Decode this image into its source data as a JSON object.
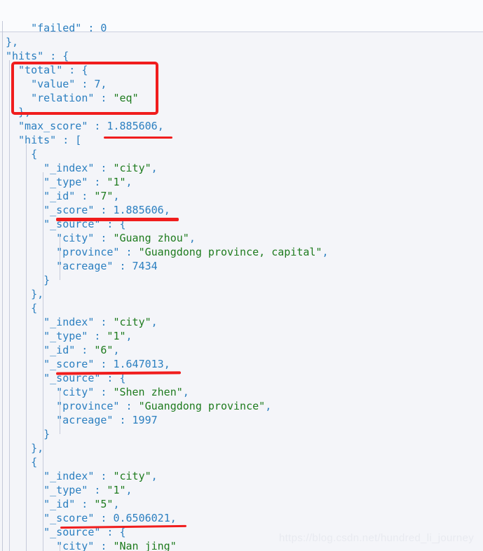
{
  "app": {
    "kind": "json-response-viewer",
    "language": "json"
  },
  "colors": {
    "background": "#f4f5f9",
    "top_band": "#fafbfd",
    "divider": "#ccd0e0",
    "key": "#2b7fc0",
    "string": "#1e7b1e",
    "annotation": "#f01d1d",
    "indent_guide": "#c6cbdb",
    "watermark": "#e8eaf0"
  },
  "code_lines": [
    {
      "indent": 4,
      "text": "\"failed\" : 0",
      "clipped": true
    },
    {
      "indent": 0,
      "text": "},"
    },
    {
      "indent": 0,
      "text": "\"hits\" : {"
    },
    {
      "indent": 2,
      "text": "\"total\" : {"
    },
    {
      "indent": 4,
      "text": "\"value\" : 7,"
    },
    {
      "indent": 4,
      "text": "\"relation\" : \"eq\""
    },
    {
      "indent": 2,
      "text": "},"
    },
    {
      "indent": 2,
      "text": "\"max_score\" : 1.885606,"
    },
    {
      "indent": 2,
      "text": "\"hits\" : ["
    },
    {
      "indent": 4,
      "text": "{"
    },
    {
      "indent": 6,
      "text": "\"_index\" : \"city\","
    },
    {
      "indent": 6,
      "text": "\"_type\" : \"1\","
    },
    {
      "indent": 6,
      "text": "\"_id\" : \"7\","
    },
    {
      "indent": 6,
      "text": "\"_score\" : 1.885606,"
    },
    {
      "indent": 6,
      "text": "\"_source\" : {"
    },
    {
      "indent": 8,
      "text": "\"city\" : \"Guang zhou\","
    },
    {
      "indent": 8,
      "text": "\"province\" : \"Guangdong province, capital\","
    },
    {
      "indent": 8,
      "text": "\"acreage\" : 7434"
    },
    {
      "indent": 6,
      "text": "}"
    },
    {
      "indent": 4,
      "text": "},"
    },
    {
      "indent": 4,
      "text": "{"
    },
    {
      "indent": 6,
      "text": "\"_index\" : \"city\","
    },
    {
      "indent": 6,
      "text": "\"_type\" : \"1\","
    },
    {
      "indent": 6,
      "text": "\"_id\" : \"6\","
    },
    {
      "indent": 6,
      "text": "\"_score\" : 1.647013,"
    },
    {
      "indent": 6,
      "text": "\"_source\" : {"
    },
    {
      "indent": 8,
      "text": "\"city\" : \"Shen zhen\","
    },
    {
      "indent": 8,
      "text": "\"province\" : \"Guangdong province\","
    },
    {
      "indent": 8,
      "text": "\"acreage\" : 1997"
    },
    {
      "indent": 6,
      "text": "}"
    },
    {
      "indent": 4,
      "text": "},"
    },
    {
      "indent": 4,
      "text": "{"
    },
    {
      "indent": 6,
      "text": "\"_index\" : \"city\","
    },
    {
      "indent": 6,
      "text": "\"_type\" : \"1\","
    },
    {
      "indent": 6,
      "text": "\"_id\" : \"5\","
    },
    {
      "indent": 6,
      "text": "\"_score\" : 0.6506021,"
    },
    {
      "indent": 6,
      "text": "\"_source\" : {"
    },
    {
      "indent": 8,
      "text": "\"city\" : \"Nan jing\"",
      "clipped": true
    }
  ],
  "response": {
    "hits": {
      "total": {
        "value": 7,
        "relation": "eq"
      },
      "max_score": 1.885606,
      "hits": [
        {
          "_index": "city",
          "_type": "1",
          "_id": "7",
          "_score": 1.885606,
          "_source": {
            "city": "Guang zhou",
            "province": "Guangdong province, capital",
            "acreage": 7434
          }
        },
        {
          "_index": "city",
          "_type": "1",
          "_id": "6",
          "_score": 1.647013,
          "_source": {
            "city": "Shen zhen",
            "province": "Guangdong province",
            "acreage": 1997
          }
        },
        {
          "_index": "city",
          "_type": "1",
          "_id": "5",
          "_score": 0.6506021,
          "_source": {
            "city": "Nan jing"
          }
        }
      ]
    }
  },
  "annotations": {
    "total_box": {
      "label": "red-rectangle-around-total-block",
      "target": "\"total\" : { \"value\" : 7, \"relation\" : \"eq\" }"
    },
    "underlines": [
      {
        "label": "max-score-underline",
        "target": "1.885606"
      },
      {
        "label": "first-hit-score-underline",
        "target": "_score : 1.885606"
      },
      {
        "label": "second-hit-score-underline",
        "target": "_score : 1.647013"
      },
      {
        "label": "third-hit-score-underline",
        "target": "_score : 0.6506021"
      }
    ]
  },
  "watermark": {
    "text": "https://blog.csdn.net/hundred_li_journey"
  }
}
